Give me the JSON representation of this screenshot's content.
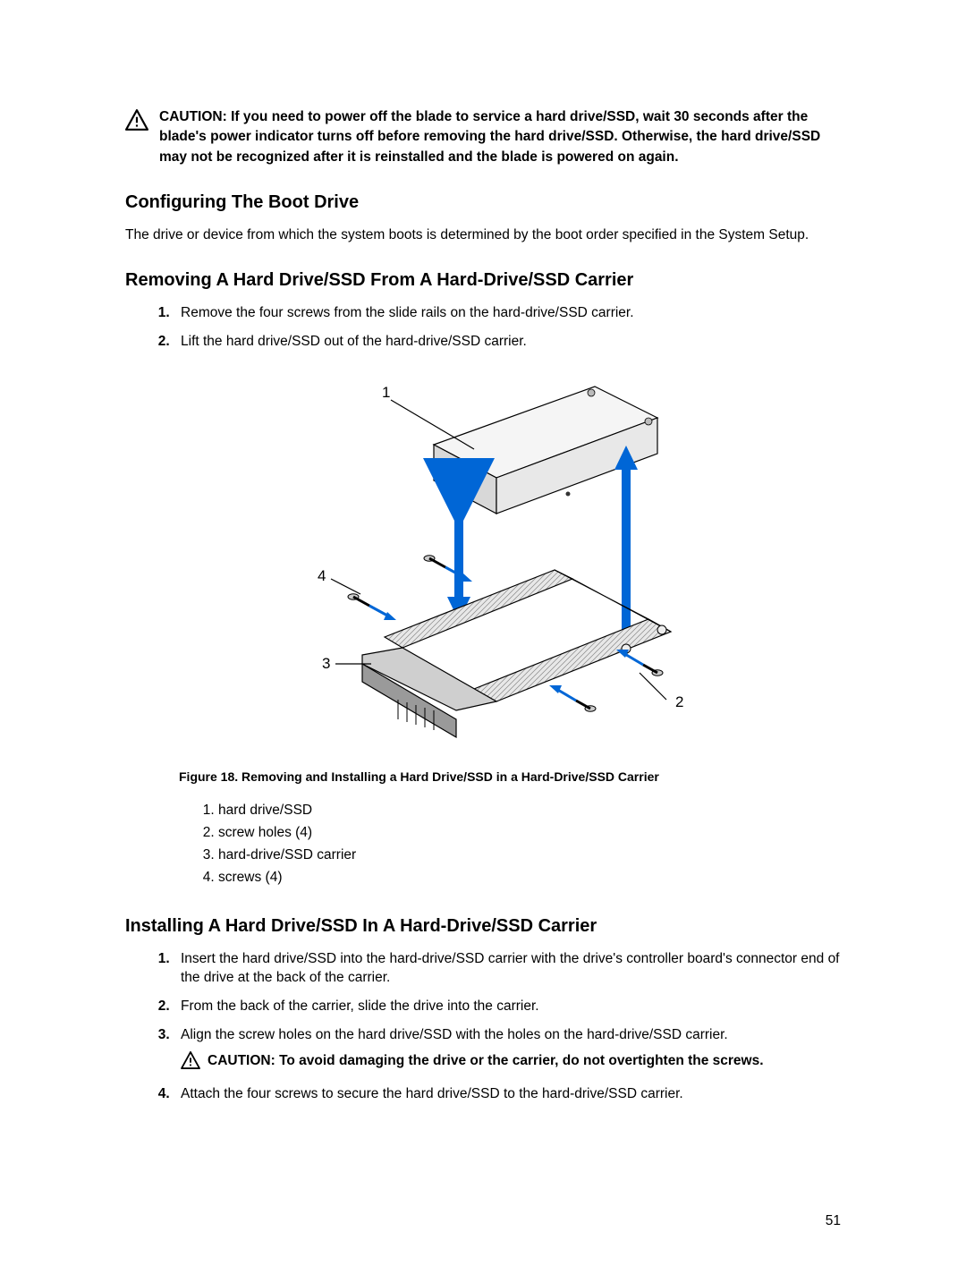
{
  "caution1": "CAUTION: If you need to power off the blade to service a hard drive/SSD, wait 30 seconds after the blade's power indicator turns off before removing the hard drive/SSD. Otherwise, the hard drive/SSD may not be recognized after it is reinstalled and the blade is powered on again.",
  "section1": {
    "heading": "Configuring The Boot Drive",
    "body": "The drive or device from which the system boots is determined by the boot order specified in the System Setup."
  },
  "section2": {
    "heading": "Removing A Hard Drive/SSD From A Hard-Drive/SSD Carrier",
    "steps": [
      "Remove the four screws from the slide rails on the hard-drive/SSD carrier.",
      "Lift the hard drive/SSD out of the hard-drive/SSD carrier."
    ]
  },
  "figure": {
    "callouts": {
      "c1": "1",
      "c2": "2",
      "c3": "3",
      "c4": "4"
    },
    "caption": "Figure 18. Removing and Installing a Hard Drive/SSD in a Hard-Drive/SSD Carrier",
    "legend": [
      "hard drive/SSD",
      "screw holes (4)",
      "hard-drive/SSD carrier",
      "screws (4)"
    ]
  },
  "section3": {
    "heading": "Installing A Hard Drive/SSD In A Hard-Drive/SSD Carrier",
    "steps": [
      "Insert the hard drive/SSD into the hard-drive/SSD carrier with the drive's controller board's connector end of the drive at the back of the carrier.",
      "From the back of the carrier, slide the drive into the carrier.",
      "Align the screw holes on the hard drive/SSD with the holes on the hard-drive/SSD carrier.",
      "Attach the four screws to secure the hard drive/SSD to the hard-drive/SSD carrier."
    ],
    "inline_caution": "CAUTION: To avoid damaging the drive or the carrier, do not overtighten the screws."
  },
  "page_number": "51"
}
